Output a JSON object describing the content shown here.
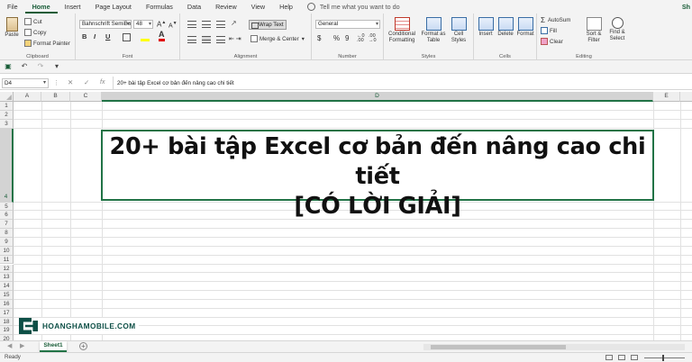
{
  "menu": {
    "tabs": [
      "File",
      "Home",
      "Insert",
      "Page Layout",
      "Formulas",
      "Data",
      "Review",
      "View",
      "Help"
    ],
    "active": "Home",
    "tell_me": "Tell me what you want to do",
    "share": "Sh"
  },
  "ribbon": {
    "clipboard": {
      "paste": "Paste",
      "cut": "Cut",
      "copy": "Copy",
      "format_painter": "Format Painter",
      "label": "Clipboard"
    },
    "font": {
      "font_name": "Bahnschrift SemiBo",
      "font_size": "48",
      "bold": "B",
      "italic": "I",
      "underline": "U",
      "label": "Font"
    },
    "alignment": {
      "wrap_text": "Wrap Text",
      "merge_center": "Merge & Center",
      "label": "Alignment"
    },
    "number": {
      "format": "General",
      "currency": "$",
      "percent": "%",
      "comma": "9",
      "label": "Number"
    },
    "styles": {
      "conditional": [
        "Conditional",
        "Formatting"
      ],
      "format_table": [
        "Format as",
        "Table"
      ],
      "cell_styles": [
        "Cell",
        "Styles"
      ],
      "label": "Styles"
    },
    "cells": {
      "insert": "Insert",
      "delete": "Delete",
      "format": "Format",
      "label": "Cells"
    },
    "editing": {
      "autosum": "AutoSum",
      "fill": "Fill",
      "clear": "Clear",
      "sort_filter": [
        "Sort &",
        "Filter"
      ],
      "find_select": [
        "Find &",
        "Select"
      ],
      "label": "Editing"
    }
  },
  "formula_bar": {
    "name_box": "D4",
    "content": "20+ bài tập Excel cơ bản đến nâng cao chi tiết"
  },
  "grid": {
    "columns": [
      "A",
      "B",
      "C",
      "D",
      "E"
    ],
    "rows": [
      "1",
      "2",
      "3",
      "4",
      "5",
      "6",
      "7",
      "8",
      "9",
      "10",
      "11",
      "12",
      "13",
      "14",
      "15",
      "16",
      "17",
      "18",
      "19",
      "20"
    ],
    "selected_column": "D",
    "selected_row": "4",
    "cell_d4_line1": "20+ bài tập Excel cơ bản đến nâng cao chi tiết",
    "cell_d4_line2": "[CÓ LỜI GIẢI]"
  },
  "watermark": {
    "text": "HOANGHAMOBILE.COM",
    "color": "#0d4f46"
  },
  "sheets": {
    "tabs": [
      "Sheet1"
    ],
    "active": "Sheet1"
  },
  "status": {
    "text": "Ready"
  },
  "colors": {
    "accent": "#217346",
    "accent_dark": "#185c37"
  }
}
